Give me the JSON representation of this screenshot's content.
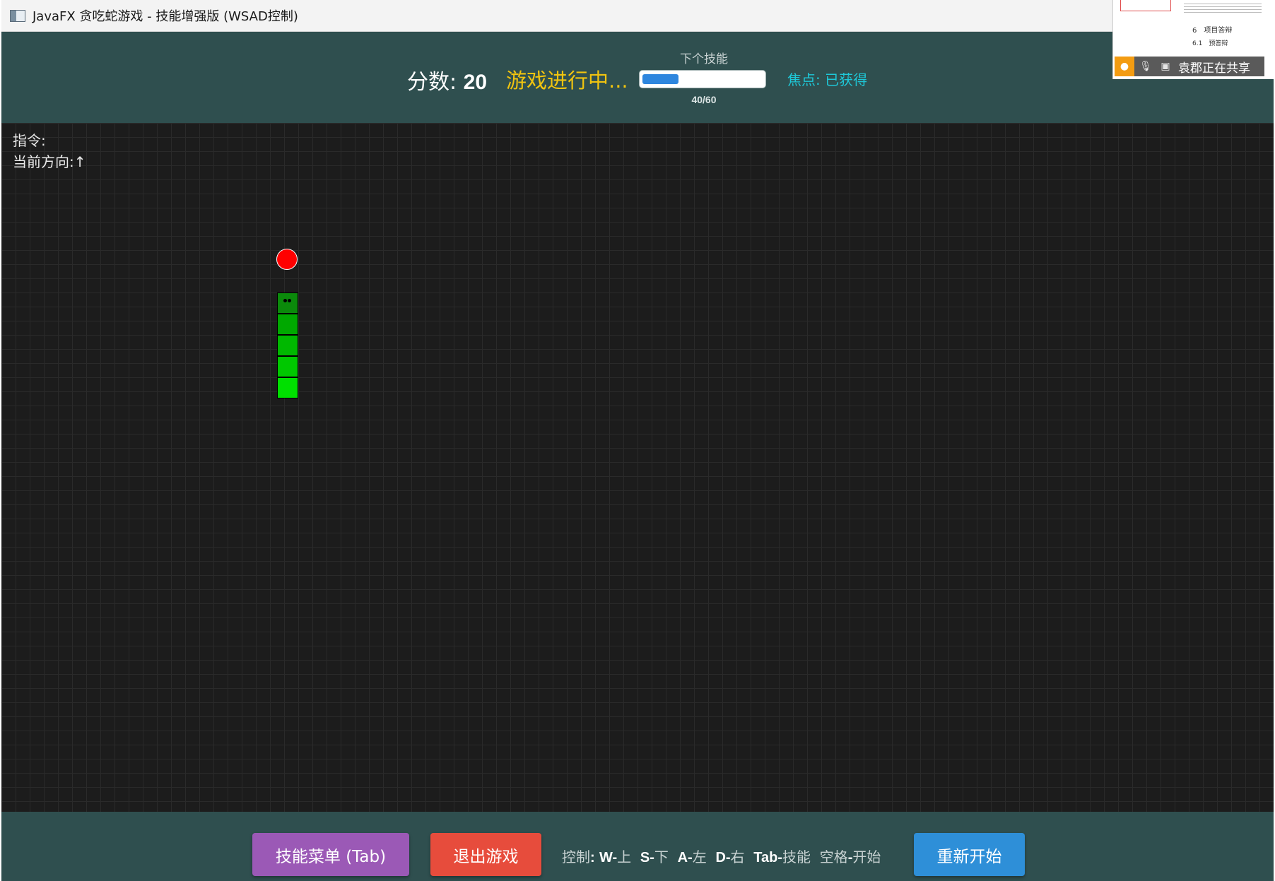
{
  "window": {
    "title": "JavaFX 贪吃蛇游戏 - 技能增强版 (WSAD控制)"
  },
  "hud": {
    "score_label": "分数:",
    "score_value": "20",
    "status": "游戏进行中...",
    "skill_caption": "下个技能",
    "skill_progress_text": "40/60",
    "skill_progress_fraction": 0.3,
    "focus_label": "焦点:",
    "focus_value": "已获得",
    "colors": {
      "bar_background": "#2f4f4f",
      "status": "#f1c40f",
      "focus": "#1ec8d8",
      "progress_fill": "#2e86de"
    }
  },
  "game": {
    "instruction_label": "指令:",
    "direction_label": "当前方向:",
    "direction_value": "↑",
    "colors": {
      "background": "#1c1c1c",
      "grid": "#2a2a2a",
      "food": "#ff0000",
      "snake_head": "#0b8a0b",
      "snake_body": [
        "#00a800",
        "#00b800",
        "#00c800",
        "#00e000"
      ]
    }
  },
  "bottom": {
    "skill_menu_button": "技能菜单 (Tab)",
    "exit_button": "退出游戏",
    "restart_button": "重新开始",
    "controls_prefix": "控制",
    "controls": [
      {
        "key": "W-",
        "action": "上"
      },
      {
        "key": "S-",
        "action": "下"
      },
      {
        "key": "A-",
        "action": "左"
      },
      {
        "key": "D-",
        "action": "右"
      },
      {
        "key": "Tab-",
        "action": "技能"
      },
      {
        "key": "-",
        "label": "空格",
        "action": "开始"
      }
    ],
    "colors": {
      "skill_menu": "#9b59b6",
      "exit": "#e74c3c",
      "restart": "#2e8fd8"
    }
  },
  "share_overlay": {
    "doc_line_1": "6　项目答辩",
    "doc_line_2": "6.1　预答辩",
    "sharing_text": "袁郡正在共享",
    "icons": [
      "user-icon",
      "microphone-icon",
      "screen-share-icon"
    ]
  }
}
